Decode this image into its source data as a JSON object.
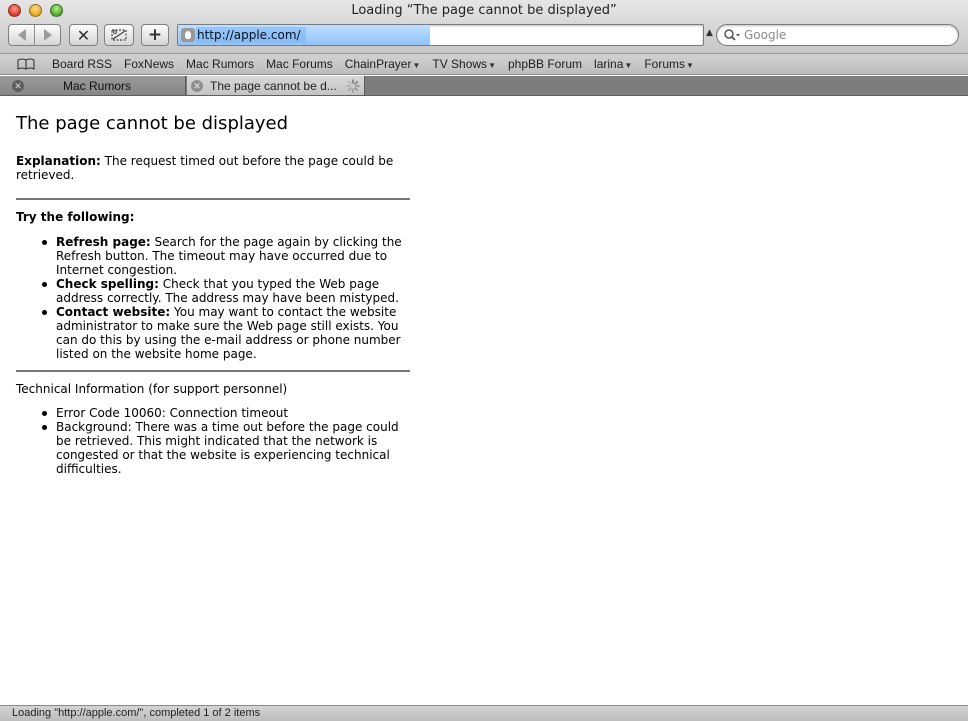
{
  "window": {
    "title": "Loading “The page cannot be displayed”"
  },
  "toolbar": {
    "address": "http://apple.com/",
    "address_load_progress": 0.48,
    "search_placeholder": "Google"
  },
  "bookmarks": [
    {
      "label": "Board RSS",
      "menu": false
    },
    {
      "label": "FoxNews",
      "menu": false
    },
    {
      "label": "Mac Rumors",
      "menu": false
    },
    {
      "label": "Mac Forums",
      "menu": false
    },
    {
      "label": "ChainPrayer",
      "menu": true
    },
    {
      "label": "TV Shows",
      "menu": true
    },
    {
      "label": "phpBB Forum",
      "menu": false
    },
    {
      "label": "larina",
      "menu": true
    },
    {
      "label": "Forums",
      "menu": true
    }
  ],
  "tabs": [
    {
      "label": "Mac Rumors",
      "active": false,
      "loading": false
    },
    {
      "label": "The page cannot be d...",
      "active": true,
      "loading": true
    }
  ],
  "page": {
    "heading": "The page cannot be displayed",
    "explanation_label": "Explanation:",
    "explanation_text": " The request timed out before the page could be retrieved.",
    "try_heading": "Try the following:",
    "try_items": [
      {
        "label": "Refresh page:",
        "text": " Search for the page again by clicking the Refresh button. The timeout may have occurred due to Internet congestion."
      },
      {
        "label": "Check spelling:",
        "text": " Check that you typed the Web page address correctly. The address may have been mistyped."
      },
      {
        "label": "Contact website:",
        "text": " You may want to contact the website administrator to make sure the Web page still exists. You can do this by using the e-mail address or phone number listed on the website home page."
      }
    ],
    "tech_heading": "Technical Information (for support personnel)",
    "tech_items": [
      "Error Code 10060: Connection timeout",
      "Background: There was a time out before the page could be retrieved. This might indicated that the network is congested or that the website is experiencing technical difficulties."
    ]
  },
  "status": {
    "text": "Loading \"http://apple.com/\", completed 1 of 2 items"
  }
}
